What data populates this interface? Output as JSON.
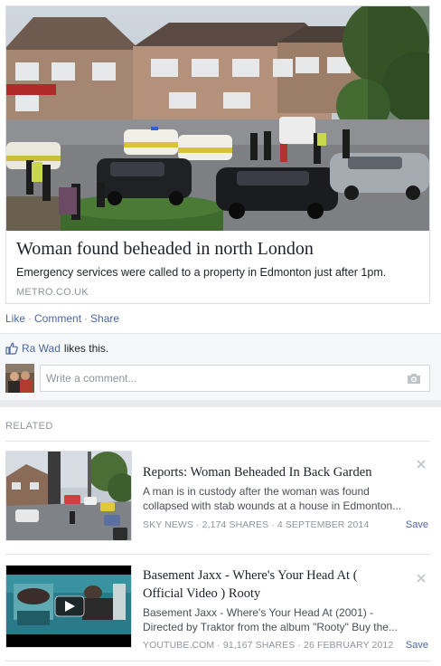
{
  "story": {
    "title": "Woman found beheaded in north London",
    "description": "Emergency services were called to a property in Edmonton just after 1pm.",
    "source": "METRO.CO.UK"
  },
  "actions": {
    "like": "Like",
    "comment": "Comment",
    "share": "Share",
    "separator": "·"
  },
  "ufi": {
    "liker": "Ra Wad",
    "likes_text": "likes this.",
    "comment_placeholder": "Write a comment..."
  },
  "related": {
    "header": "RELATED",
    "items": [
      {
        "title": "Reports: Woman Beheaded In Back Garden",
        "description": "A man is in custody after the woman was found collapsed with stab wounds at a house in Edmonton...",
        "meta": "SKY NEWS · 2,174 SHARES · 4 SEPTEMBER 2014",
        "save": "Save"
      },
      {
        "title": "Basement Jaxx - Where's Your Head At ( Official Video ) Rooty",
        "description": "Basement Jaxx - Where's Your Head At (2001) - Directed by Traktor from the album \"Rooty\" Buy the...",
        "meta": "YOUTUBE.COM · 91,167 SHARES · 26 FEBRUARY 2012",
        "save": "Save"
      }
    ]
  },
  "colors": {
    "link": "#4b67a1",
    "muted": "#90949c",
    "text": "#1d2129",
    "panel": "#f6f7f9"
  },
  "icons": [
    "like-thumb-icon",
    "camera-icon",
    "close-icon",
    "play-icon"
  ]
}
